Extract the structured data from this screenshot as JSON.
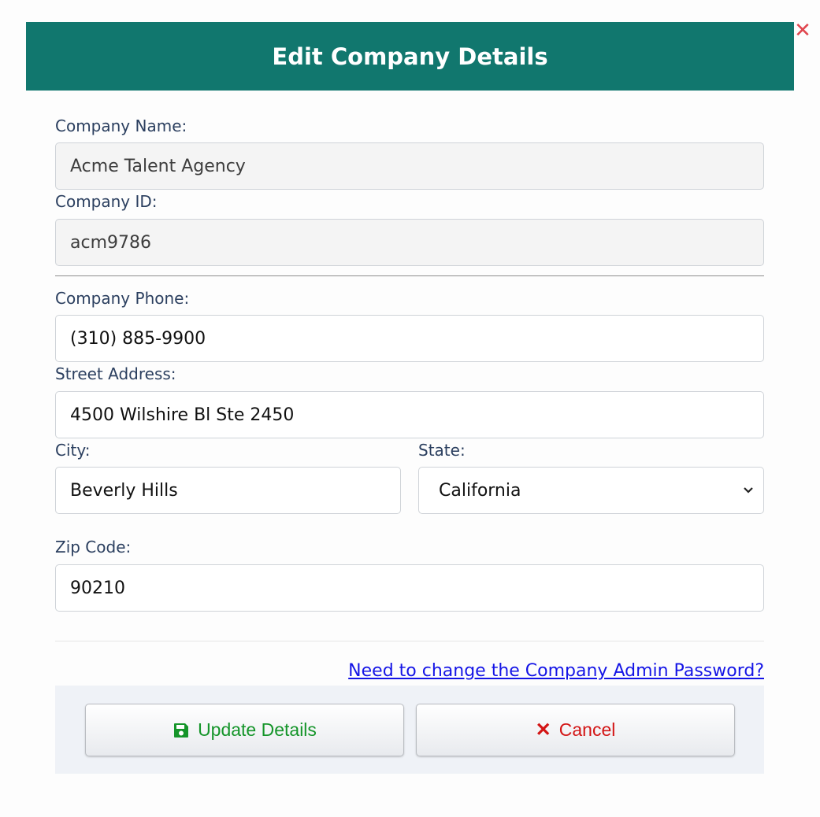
{
  "dialog": {
    "title": "Edit Company Details",
    "close_glyph": "✕"
  },
  "form": {
    "company_name": {
      "label": "Company Name:",
      "value": "Acme Talent Agency"
    },
    "company_id": {
      "label": "Company ID:",
      "value": "acm9786"
    },
    "company_phone": {
      "label": "Company Phone:",
      "value": "(310) 885-9900"
    },
    "street_address": {
      "label": "Street Address:",
      "value": "4500 Wilshire Bl Ste 2450"
    },
    "city": {
      "label": "City:",
      "value": "Beverly Hills"
    },
    "state": {
      "label": "State:",
      "value": "California"
    },
    "zip_code": {
      "label": "Zip Code:",
      "value": "90210"
    }
  },
  "links": {
    "change_password": "Need to change the Company Admin Password?"
  },
  "buttons": {
    "update": "Update Details",
    "cancel": "Cancel",
    "cancel_glyph": "✕"
  },
  "colors": {
    "header": "#11776e",
    "update_text": "#15952a",
    "cancel_text": "#d31515",
    "link": "#1414e6"
  }
}
